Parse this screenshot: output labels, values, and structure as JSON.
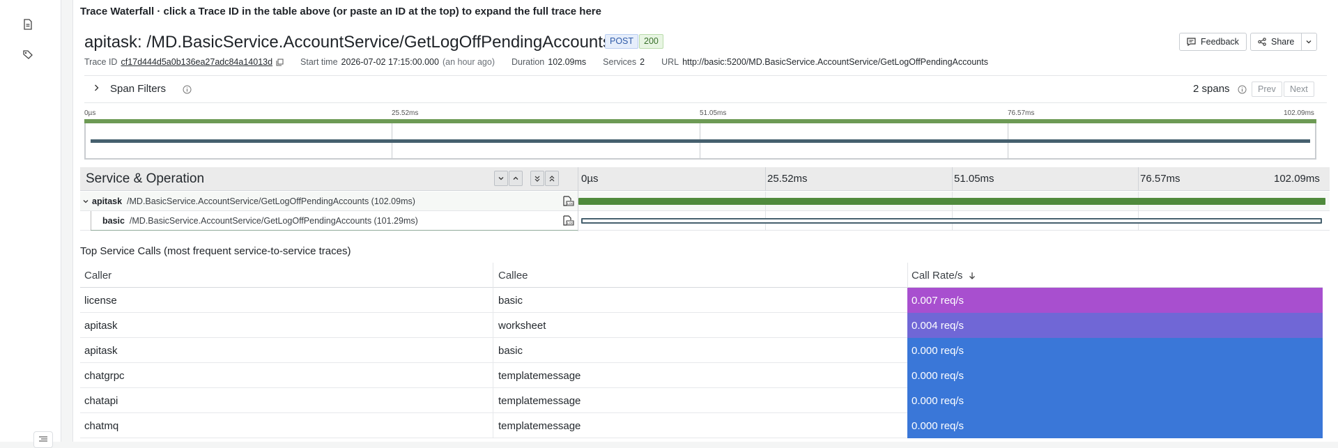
{
  "sidebar": {
    "icons": [
      {
        "name": "document-icon"
      },
      {
        "name": "tag-icon"
      }
    ]
  },
  "panel": {
    "title": "Trace Waterfall · click a Trace ID in the table above (or paste an ID at the top) to expand the full trace here"
  },
  "trace": {
    "title": "apitask: /MD.BasicService.AccountService/GetLogOffPendingAccounts",
    "method": "POST",
    "status": "200",
    "feedback_label": "Feedback",
    "share_label": "Share",
    "trace_id_label": "Trace ID",
    "trace_id": "cf17d444d5a0b136ea27adc84a14013d",
    "start_time_label": "Start time",
    "start_time": "2026-07-02 17:15:00.000",
    "start_time_relative": "(an hour ago)",
    "duration_label": "Duration",
    "duration": "102.09ms",
    "services_label": "Services",
    "services": "2",
    "url_label": "URL",
    "url": "http://basic:5200/MD.BasicService.AccountService/GetLogOffPendingAccounts"
  },
  "filters": {
    "label": "Span Filters",
    "spans_count": "2 spans",
    "prev_label": "Prev",
    "next_label": "Next"
  },
  "timeline": {
    "ticks": [
      "0µs",
      "25.52ms",
      "51.05ms",
      "76.57ms",
      "102.09ms"
    ],
    "total_ms": 102.09
  },
  "waterfall": {
    "header": "Service & Operation",
    "spans": [
      {
        "service": "apitask",
        "operation": "/MD.BasicService.AccountService/GetLogOffPendingAccounts (102.09ms)",
        "start_ms": 0,
        "duration_ms": 102.09,
        "color": "#4f8a3c",
        "expanded": true
      },
      {
        "service": "basic",
        "operation": "/MD.BasicService.AccountService/GetLogOffPendingAccounts (101.29ms)",
        "start_ms": 0.35,
        "duration_ms": 101.29,
        "color": "#46606e",
        "expanded": false
      }
    ]
  },
  "calls": {
    "title": "Top Service Calls (most frequent service-to-service traces)",
    "headers": {
      "caller": "Caller",
      "callee": "Callee",
      "rate": "Call Rate/s"
    },
    "rows": [
      {
        "caller": "license",
        "callee": "basic",
        "rate": "0.007 req/s",
        "color": "#a84fcf"
      },
      {
        "caller": "apitask",
        "callee": "worksheet",
        "rate": "0.004 req/s",
        "color": "#7067d6"
      },
      {
        "caller": "apitask",
        "callee": "basic",
        "rate": "0.000 req/s",
        "color": "#3a77d8"
      },
      {
        "caller": "chatgrpc",
        "callee": "templatemessage",
        "rate": "0.000 req/s",
        "color": "#3a77d8"
      },
      {
        "caller": "chatapi",
        "callee": "templatemessage",
        "rate": "0.000 req/s",
        "color": "#3a77d8"
      },
      {
        "caller": "chatmq",
        "callee": "templatemessage",
        "rate": "0.000 req/s",
        "color": "#3a77d8"
      }
    ]
  }
}
